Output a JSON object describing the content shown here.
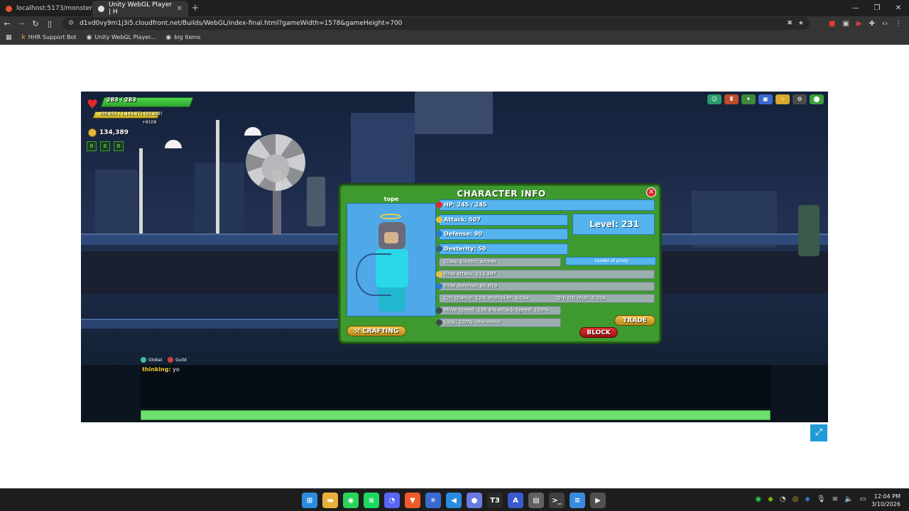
{
  "browser": {
    "tabs": [
      {
        "title": "localhost:5173/monsters",
        "active": false,
        "favicon_color": "#e8542a"
      },
      {
        "title": "Unity WebGL Player | H",
        "active": true,
        "favicon_color": "#e0e0e0"
      }
    ],
    "new_tab_label": "+",
    "url": "d1vd0vy9m1j3i5.cloudfront.net/Builds/WebGL/index-final.html?gameWidth=1578&gameHeight=700",
    "bookmarks": [
      {
        "label": "HHR Support Bot",
        "icon": "bot-icon"
      },
      {
        "label": "Unity WebGL Player...",
        "icon": "unity-icon"
      },
      {
        "label": "big items",
        "icon": "unity-icon"
      }
    ]
  },
  "hud": {
    "hp_text": "283 / 283",
    "xp_text": "496,933 / 1,143,371 (43.382)",
    "xp_extra": "+8108",
    "gold_text": "134,389",
    "slots": [
      "B",
      "B",
      "B"
    ]
  },
  "character_info": {
    "title": "CHARACTER INFO",
    "close_label": "✕",
    "name": "tope",
    "hp": "HP: 245 / 245",
    "attack": "Attack: 507",
    "defense": "Defense: 90",
    "dexterity": "Dexterity: 50",
    "level": "Level: 231",
    "class": "Class: Electric Archer",
    "guild": "Leader of piney",
    "final_attack": "Final attack: 213.397",
    "final_defense": "Final defense: 60.819",
    "crit": "Crit chance: 12%  multiplier: 4.04x",
    "orb_crit": "Orb crit mult: 0.00x",
    "move_speed": "Move Speed: 138.6%  Attack Speed: 100%",
    "luck": "Luck: 100%",
    "luck_note": "(drop chance)",
    "crafting_label": "CRAFTING",
    "trade_label": "TRADE",
    "block_label": "BLOCK"
  },
  "chat": {
    "tabs": [
      {
        "label": "Global",
        "color": "#3ac0a0"
      },
      {
        "label": "Guild",
        "color": "#d04040"
      }
    ],
    "messages": [
      {
        "name": "thinking:",
        "text": " yo"
      }
    ]
  },
  "taskbar": {
    "time": "12:04 PM",
    "date": "3/10/2026",
    "apps": [
      {
        "icon": "windows-icon",
        "color": "#2b8de0",
        "glyph": "⊞"
      },
      {
        "icon": "folder-icon",
        "color": "#e8b03a",
        "glyph": "▬"
      },
      {
        "icon": "whatsapp-icon",
        "color": "#2ad35a",
        "glyph": "◉"
      },
      {
        "icon": "spotify-icon",
        "color": "#1ed760",
        "glyph": "≋"
      },
      {
        "icon": "discord-icon",
        "color": "#5865f2",
        "glyph": "◔"
      },
      {
        "icon": "brave-icon",
        "color": "#f05a2a",
        "glyph": "▼"
      },
      {
        "icon": "app-icon",
        "color": "#3a6ad0",
        "glyph": "✳"
      },
      {
        "icon": "vscode-icon",
        "color": "#2a8ae0",
        "glyph": "◀"
      },
      {
        "icon": "chat-icon",
        "color": "#6a7ae0",
        "glyph": "●"
      },
      {
        "icon": "t3-icon",
        "color": "#2a2a2a",
        "glyph": "T3"
      },
      {
        "icon": "font-icon",
        "color": "#3a5ad0",
        "glyph": "A"
      },
      {
        "icon": "paint-icon",
        "color": "#606060",
        "glyph": "▤"
      },
      {
        "icon": "terminal-icon",
        "color": "#404040",
        "glyph": ">_"
      },
      {
        "icon": "notepad-icon",
        "color": "#3a8ae0",
        "glyph": "≡"
      },
      {
        "icon": "media-icon",
        "color": "#505050",
        "glyph": "▶"
      }
    ]
  }
}
